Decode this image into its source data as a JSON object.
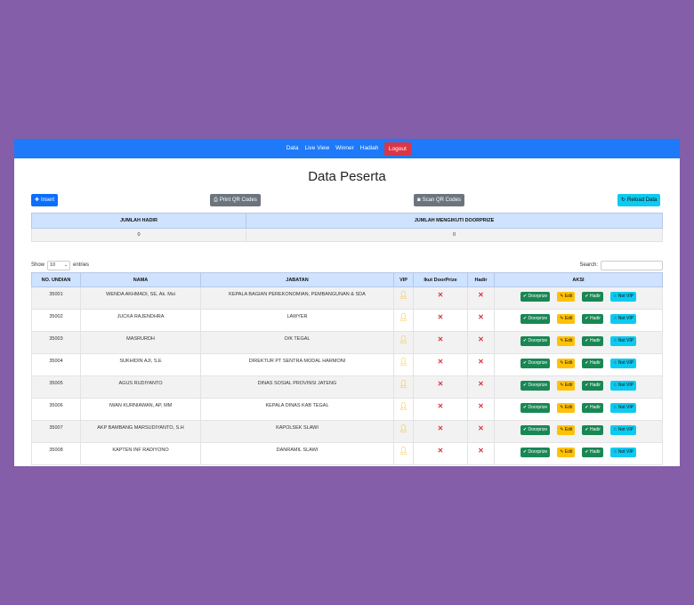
{
  "nav": {
    "items": [
      "Data",
      "Live View",
      "Winner",
      "Hadiah"
    ],
    "logout": "Logout"
  },
  "page": {
    "title": "Data Peserta"
  },
  "toolbar": {
    "insert": "Insert",
    "print_qr": "Print QR Codes",
    "scan_qr": "Scan QR Codes",
    "reload": "Reload Data"
  },
  "summary": {
    "headers": [
      "JUMLAH HADIR",
      "JUMLAH MENGIKUTI DOORPRIZE"
    ],
    "values": [
      "0",
      "0"
    ]
  },
  "table_controls": {
    "show_label": "Show",
    "entries_value": "10",
    "entries_label": "entries",
    "search_label": "Search:"
  },
  "table": {
    "headers": [
      "NO. UNDIAN",
      "NAMA",
      "JABATAN",
      "VIP",
      "Ikut DoorPrize",
      "Hadir",
      "AKSI"
    ],
    "action_labels": {
      "doorprize": "Doorprize",
      "edit": "Edit",
      "hadir": "Hadir",
      "not_vip": "Not VIP"
    },
    "rows": [
      {
        "no": "35001",
        "nama": "WENDA AKHMADI, SE, Ak. Msi",
        "jabatan": "KEPALA BAGIAN PEREKONOMIAN, PEMBANGUNAN & SDA"
      },
      {
        "no": "35002",
        "nama": "JUCKA RAJENDHRA",
        "jabatan": "LAWYER"
      },
      {
        "no": "35003",
        "nama": "MASRURDH",
        "jabatan": "O/K TEGAL"
      },
      {
        "no": "35004",
        "nama": "SUKHIDIN AJI, S.E",
        "jabatan": "DIREKTUR PT SENTRA MODAL HARMONI"
      },
      {
        "no": "35005",
        "nama": "AGUS RUDIYANTO",
        "jabatan": "DINAS SOSIAL PROVINSI JATENG"
      },
      {
        "no": "35006",
        "nama": "IWAN KURNIAWAN, AP, MM",
        "jabatan": "KEPALA DINAS KAB TEGAL"
      },
      {
        "no": "35007",
        "nama": "AKP BAMBANG MARSUDIYANTO, S.H",
        "jabatan": "KAPOLSEK SLAWI"
      },
      {
        "no": "35008",
        "nama": "KAPTEN INF RADIYONO",
        "jabatan": "DANRAMIL SLAWI"
      }
    ]
  },
  "colors": {
    "navbar": "#1e7af8",
    "background": "#845ea8",
    "primary": "#0d6efd",
    "secondary": "#6c757d",
    "info": "#0dcaf0",
    "success": "#198754",
    "warning": "#ffc107",
    "danger": "#dc3545"
  }
}
